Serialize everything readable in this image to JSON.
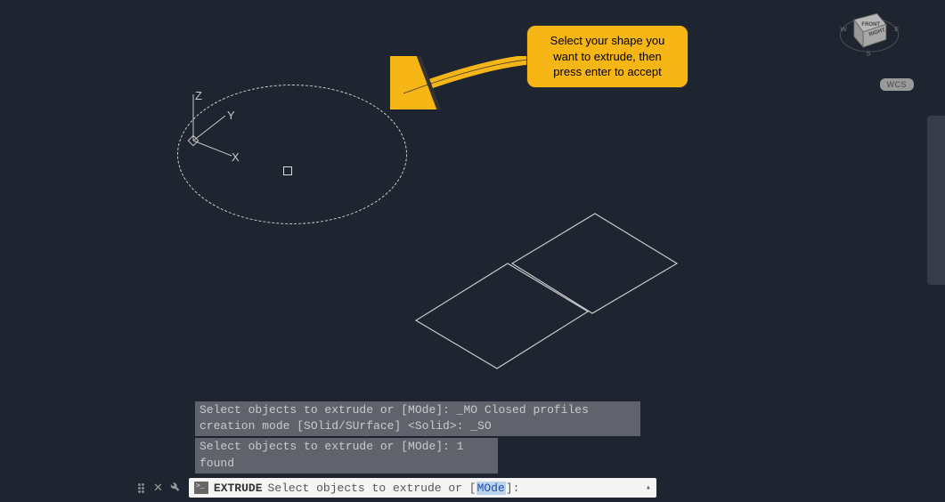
{
  "viewport": {
    "ucs": {
      "x_label": "X",
      "y_label": "Y",
      "z_label": "Z"
    },
    "wcs_badge": "WCS",
    "viewcube": {
      "faces": [
        "FRONT",
        "RIGHT"
      ],
      "compass": [
        "S",
        "E",
        "W"
      ]
    }
  },
  "callout": {
    "text": "Select your shape you want to extrude, then press enter to accept"
  },
  "command_history": {
    "line1": "Select objects to extrude or [MOde]: _MO Closed profiles creation mode [SOlid/SUrface] <Solid>: _SO",
    "line2": "Select objects to extrude or [MOde]: 1 found"
  },
  "command_line": {
    "command": "EXTRUDE",
    "prompt_prefix": "Select objects to extrude or [",
    "option": "MOde",
    "prompt_suffix": "]:"
  },
  "colors": {
    "accent": "#f6b616",
    "bg": "#1e2530"
  }
}
